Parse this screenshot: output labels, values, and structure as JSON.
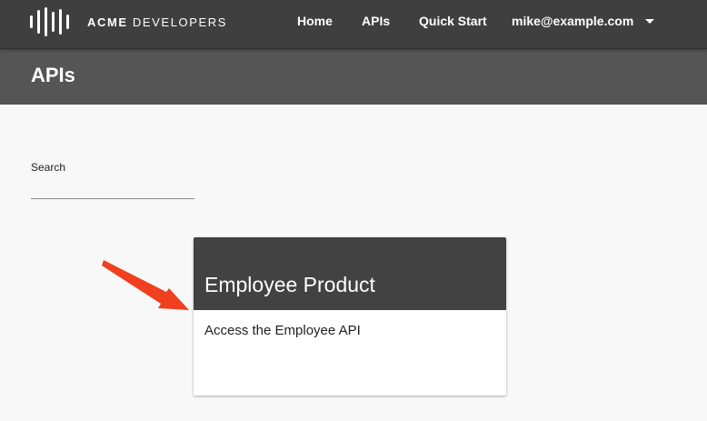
{
  "header": {
    "brand_bold": "ACME",
    "brand_rest": " DEVELOPERS",
    "logo_icon": "sound-bars-logo",
    "nav": {
      "home": "Home",
      "apis": "APIs",
      "quick_start": "Quick Start",
      "user": "mike@example.com",
      "user_menu_icon": "chevron-down-icon"
    }
  },
  "page": {
    "title": "APIs"
  },
  "search": {
    "label": "Search",
    "value": "",
    "placeholder": ""
  },
  "products": [
    {
      "title": "Employee Product",
      "description": "Access the Employee API"
    }
  ],
  "colors": {
    "topbar": "#3f3f3f",
    "title_band": "#555555",
    "card_header": "#424242",
    "background": "#f8f8f8",
    "annotation_arrow": "#f0401f"
  }
}
